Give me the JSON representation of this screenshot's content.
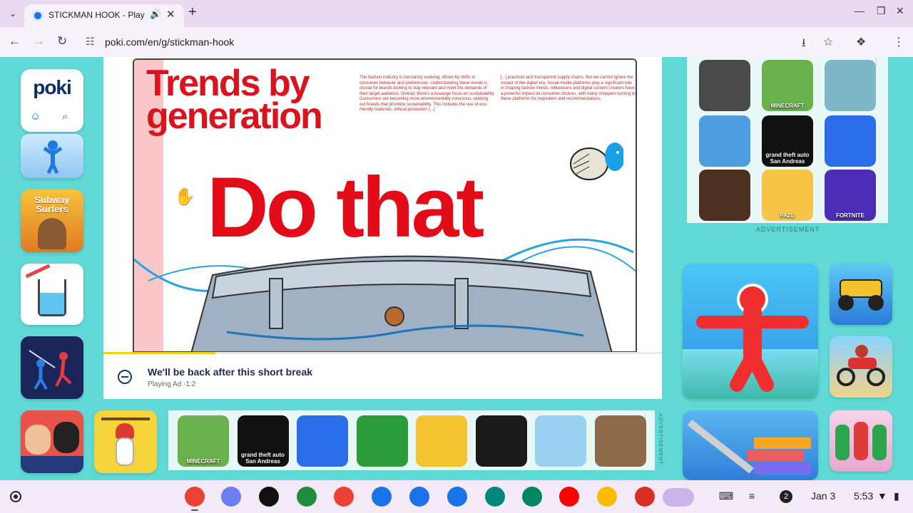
{
  "browser": {
    "tab_title": "STICKMAN HOOK - Play Online",
    "url": "poki.com/en/g/stickman-hook"
  },
  "site": {
    "logo": "poki"
  },
  "left_games": [
    {
      "label": "",
      "color": "#a5d8ff"
    },
    {
      "label": "Subway Surfers",
      "color": "#f5a623"
    },
    {
      "label": "",
      "color": "#ffffff"
    },
    {
      "label": "",
      "color": "#1e2a78"
    },
    {
      "label": "",
      "color": "#e8524a"
    },
    {
      "label": "",
      "color": "#f5d33a"
    }
  ],
  "game": {
    "magazine_title_line1": "Trends by",
    "magazine_title_line2": "generation",
    "magazine_col1": "The fashion industry is constantly evolving, driven by shifts in consumer behavior and preferences. Understanding these trends is crucial for brands looking to stay relevant and meet the demands of their target audience. Overall, there's a huuuuge focus on sustainability. Consumers are becoming more environmentally conscious, seeking out brands that prioritize sustainability. This includes the use of eco-friendly materials, ethical production [...]",
    "magazine_col2": "[...] practices and transparent supply chains. But we cannot ignore the impact of the digital era. Social media platforms play a significant role in shaping fashion trends. Influencers and digital content creators have a powerful impact on consumer choices, with many shoppers turning to these platforms for inspiration and recommendations.",
    "magazine_big": "Do that",
    "ad_title": "We'll be back after this short break",
    "ad_subtitle": "Playing Ad ·1:2",
    "ad_progress": 0.2
  },
  "right_ad": {
    "label": "ADVERTISEMENT",
    "tiles": [
      {
        "label": "",
        "color": "#4a4a4a"
      },
      {
        "label": "MINECRAFT",
        "color": "#6ab04c"
      },
      {
        "label": "",
        "color": "#7fb7c9"
      },
      {
        "label": "",
        "color": "#4d9de0"
      },
      {
        "label": "grand theft auto San Andreas",
        "color": "#111111"
      },
      {
        "label": "",
        "color": "#2b6de8"
      },
      {
        "label": "",
        "color": "#4b2f20"
      },
      {
        "label": "PAZU",
        "color": "#f7c548"
      },
      {
        "label": "FORTNITE",
        "color": "#4a2db5"
      }
    ]
  },
  "right_games": [
    {
      "label": "",
      "color": "#2fb3e8"
    },
    {
      "label": "",
      "color": "#3b7de0"
    },
    {
      "label": "",
      "color": "#2b5fb0"
    },
    {
      "label": "",
      "color": "#3b8ed8"
    },
    {
      "label": "",
      "color": "#c93535"
    }
  ],
  "bottom_ad": {
    "label": "ADVERTISEMENT",
    "tiles": [
      {
        "label": "MINECRAFT",
        "color": "#6ab04c"
      },
      {
        "label": "grand theft auto San Andreas",
        "color": "#111111"
      },
      {
        "label": "",
        "color": "#2b6de8"
      },
      {
        "label": "",
        "color": "#2a9d3a"
      },
      {
        "label": "",
        "color": "#f4c430"
      },
      {
        "label": "",
        "color": "#1a1a1a"
      },
      {
        "label": "",
        "color": "#9ad0f0"
      },
      {
        "label": "",
        "color": "#8b6b4a"
      }
    ]
  },
  "shelf": {
    "notification_count": "2",
    "date": "Jan 3",
    "time": "5:53",
    "apps": [
      {
        "name": "chrome-icon",
        "color": "#e94235"
      },
      {
        "name": "gemini-icon",
        "color": "#6b7ff0"
      },
      {
        "name": "audible-icon",
        "color": "#111111"
      },
      {
        "name": "apps-icon",
        "color": "#1e8e3e"
      },
      {
        "name": "gmail-icon",
        "color": "#ea4335"
      },
      {
        "name": "calendar-icon",
        "color": "#1a73e8"
      },
      {
        "name": "files-icon",
        "color": "#1a73e8"
      },
      {
        "name": "messages-icon",
        "color": "#1a73e8"
      },
      {
        "name": "meet-icon",
        "color": "#00897b"
      },
      {
        "name": "play-store-icon",
        "color": "#01875f"
      },
      {
        "name": "youtube-icon",
        "color": "#ff0000"
      },
      {
        "name": "photos-icon",
        "color": "#fbbc04"
      },
      {
        "name": "screen-record-icon",
        "color": "#d93025"
      }
    ]
  }
}
